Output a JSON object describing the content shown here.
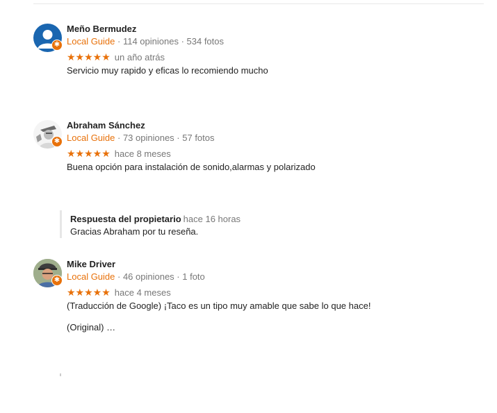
{
  "reviews": [
    {
      "name": "Meño Bermudez",
      "guide_label": "Local Guide",
      "reviews_count": "114 opiniones",
      "photos_count": "534 fotos",
      "stars": "★★★★★",
      "rating": 5,
      "date": "un año atrás",
      "text": "Servicio muy rapido y eficas lo recomiendo mucho"
    },
    {
      "name": "Abraham Sánchez",
      "guide_label": "Local Guide",
      "reviews_count": "73 opiniones",
      "photos_count": "57 fotos",
      "stars": "★★★★★",
      "rating": 5,
      "date": "hace 8 meses",
      "text": "Buena opción para instalación de sonido,alarmas y polarizado",
      "owner_reply": {
        "title": "Respuesta del propietario",
        "time": "hace 16 horas",
        "text": "Gracias Abraham por tu reseña."
      }
    },
    {
      "name": "Mike Driver",
      "guide_label": "Local Guide",
      "reviews_count": "46 opiniones",
      "photos_count": "1 foto",
      "stars": "★★★★★",
      "rating": 5,
      "date": "hace 4 meses",
      "text": "(Traducción de Google) ¡Taco es un tipo muy amable que sabe lo que hace!",
      "original": "(Original) …"
    }
  ],
  "separator": " · ",
  "colors": {
    "accent": "#e8710a",
    "muted": "#777777",
    "avatar_blue": "#1a66b0"
  },
  "icons": {
    "badge": "local-guide-badge-icon",
    "star": "star-icon"
  }
}
